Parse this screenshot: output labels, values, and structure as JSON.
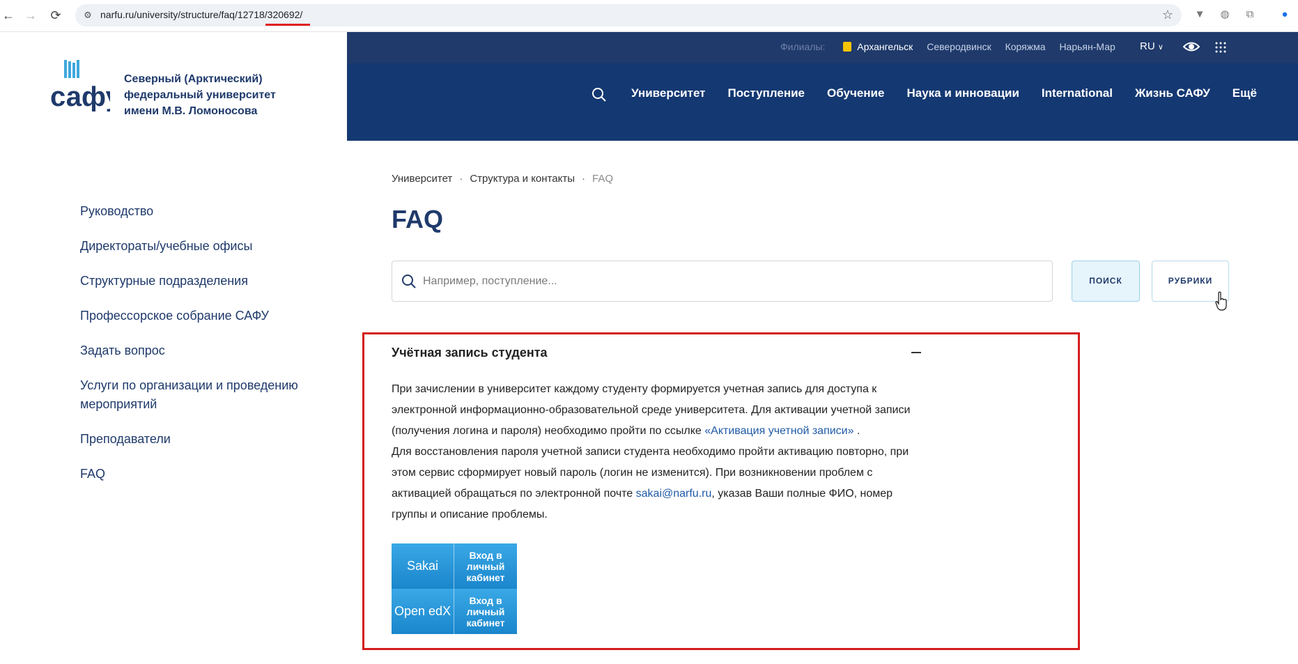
{
  "browser": {
    "url": "narfu.ru/university/structure/faq/12718/320692/"
  },
  "header": {
    "brand_name": "Северный (Арктический) федеральный университет имени М.В. Ломоносова",
    "logo_text": "сафу",
    "branches_label": "Филиалы:",
    "branches": [
      "Архангельск",
      "Северодвинск",
      "Коряжма",
      "Нарьян-Мар"
    ],
    "language": "RU",
    "nav": [
      "Университет",
      "Поступление",
      "Обучение",
      "Наука и инновации",
      "International",
      "Жизнь САФУ",
      "Ещё"
    ]
  },
  "sidebar": {
    "items": [
      "Руководство",
      "Директораты/учебные офисы",
      "Структурные подразделения",
      "Профессорское собрание САФУ",
      "Задать вопрос",
      "Услуги по организации и проведению мероприятий",
      "Преподаватели",
      "FAQ"
    ]
  },
  "main": {
    "breadcrumb": [
      "Университет",
      "Структура и контакты",
      "FAQ"
    ],
    "title": "FAQ",
    "search_placeholder": "Например, поступление...",
    "search_button": "ПОИСК",
    "rubrics_button": "РУБРИКИ",
    "faq_title": "Учётная запись студента",
    "faq_p1_a": "При зачислении в университет каждому студенту формируется учетная запись для доступа к электронной информационно-образовательной среде университета. Для активации учетной записи (получения логина и пароля) необходимо пройти по ссылке ",
    "faq_p1_link": "«Активация учетной записи»",
    "faq_p1_b": " .",
    "faq_p2_a": "Для восстановления пароля учетной записи студента необходимо пройти активацию повторно, при этом сервис сформирует новый пароль (логин не изменится). При возникновении проблем с активацией обращаться по электронной почте ",
    "faq_p2_link": "sakai@narfu.ru",
    "faq_p2_b": ", указав Ваши полные ФИО, номер группы и описание проблемы.",
    "banners": [
      {
        "left": "Sakai",
        "right": "Вход в личный кабинет"
      },
      {
        "left": "Open edX",
        "right": "Вход в личный кабинет"
      }
    ]
  }
}
